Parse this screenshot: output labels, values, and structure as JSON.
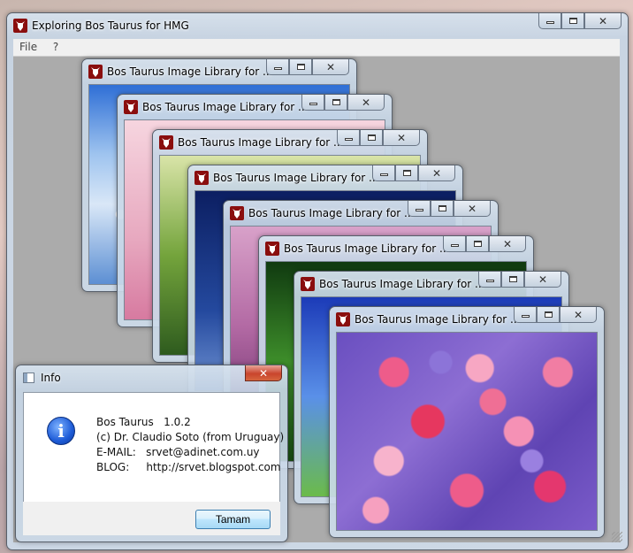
{
  "main_window": {
    "title": "Exploring Bos Taurus for HMG",
    "menu": [
      "File",
      "?"
    ]
  },
  "child_window_title": "Bos Taurus Image Library for ...",
  "dialog": {
    "title": "Info",
    "lines": [
      "Bos Taurus   1.0.2",
      "(c) Dr. Claudio Soto (from Uruguay)",
      "E-MAIL:   srvet@adinet.com.uy",
      "BLOG:     http://srvet.blogspot.com"
    ],
    "button": "Tamam"
  },
  "icons": {
    "app": "bull-head-icon",
    "dialog": "info-icon"
  }
}
